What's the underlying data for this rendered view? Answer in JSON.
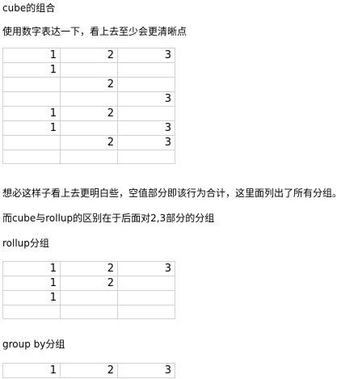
{
  "heading_cube": "cube的组合",
  "intro": "使用数字表达一下，看上去至少会更清晰点",
  "cube_table": [
    [
      "1",
      "2",
      "3"
    ],
    [
      "1",
      "",
      ""
    ],
    [
      "",
      "2",
      ""
    ],
    [
      "",
      "",
      "3"
    ],
    [
      "1",
      "2",
      ""
    ],
    [
      "1",
      "",
      "3"
    ],
    [
      "",
      "2",
      "3"
    ],
    [
      "",
      "",
      ""
    ]
  ],
  "explanation": "想必这样子看上去更明白些，空值部分即该行为合计，这里面列出了所有分组。",
  "difference": "而cube与rollup的区别在于后面对2,3部分的分组",
  "heading_rollup": "rollup分组",
  "rollup_table": [
    [
      "1",
      "2",
      "3"
    ],
    [
      "1",
      "2",
      ""
    ],
    [
      "1",
      "",
      ""
    ],
    [
      "",
      "",
      ""
    ]
  ],
  "heading_groupby": "group by分组",
  "groupby_table": [
    [
      "1",
      "2",
      "3"
    ]
  ]
}
